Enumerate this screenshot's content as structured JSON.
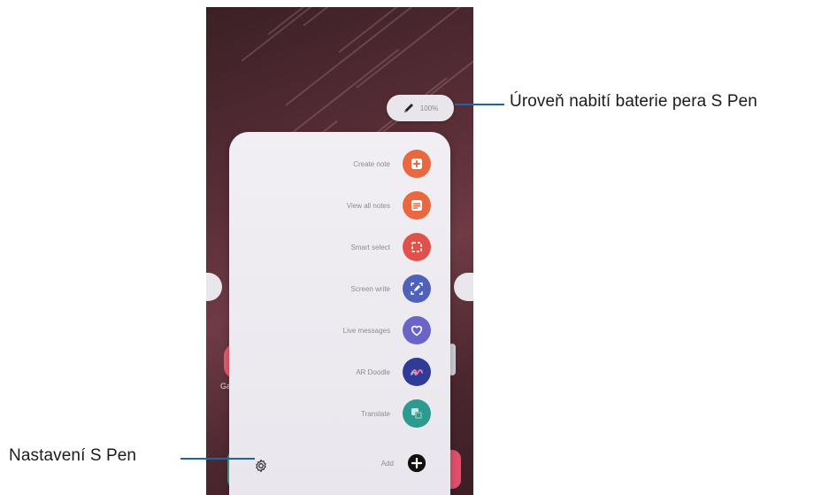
{
  "callouts": {
    "battery": "Úroveň nabití baterie pera S Pen",
    "settings": "Nastavení S Pen"
  },
  "battery_pill": {
    "value": "100%",
    "icon": "s-pen-icon"
  },
  "home_screen": {
    "app_label": "Ga"
  },
  "air_command": {
    "items": [
      {
        "label": "Create note",
        "icon": "create-note-icon",
        "color": "#e9683f"
      },
      {
        "label": "View all notes",
        "icon": "view-notes-icon",
        "color": "#e9683f"
      },
      {
        "label": "Smart select",
        "icon": "smart-select-icon",
        "color": "#e2504c"
      },
      {
        "label": "Screen write",
        "icon": "screen-write-icon",
        "color": "#4f61b8"
      },
      {
        "label": "Live messages",
        "icon": "live-messages-icon",
        "color": "#6a63c8"
      },
      {
        "label": "AR Doodle",
        "icon": "ar-doodle-icon",
        "color": "#2f3b97"
      },
      {
        "label": "Translate",
        "icon": "translate-icon",
        "color": "#2d9a8f"
      },
      {
        "label": "Add",
        "icon": "add-icon",
        "color": "#111111"
      }
    ],
    "settings_icon": "gear-icon"
  }
}
